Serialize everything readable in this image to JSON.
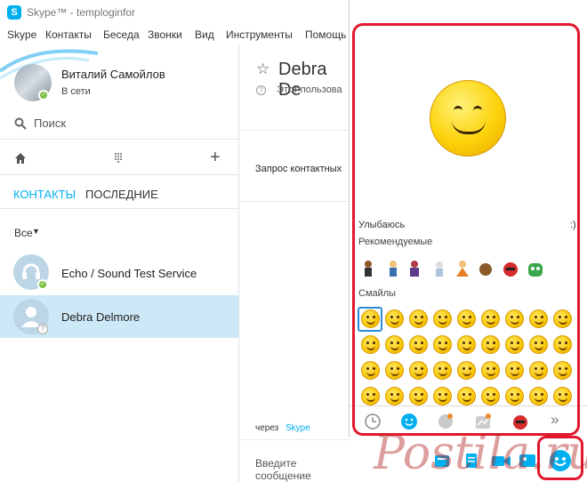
{
  "window": {
    "title": "Skype™ - temploginfor"
  },
  "menu": [
    "Skype",
    "Контакты",
    "Беседа",
    "Звонки",
    "Вид",
    "Инструменты",
    "Помощь"
  ],
  "profile": {
    "name": "Виталий Самойлов",
    "status": "В сети"
  },
  "search": {
    "label": "Поиск"
  },
  "tabs": {
    "contacts": "КОНТАКТЫ",
    "recent": "ПОСЛЕДНИЕ"
  },
  "filter": {
    "label": "Все"
  },
  "contacts": [
    {
      "name": "Echo / Sound Test Service"
    },
    {
      "name": "Debra Delmore"
    }
  ],
  "chat": {
    "title": "Debra De",
    "subtitle": "Этот пользова",
    "request": "Запрос контактных",
    "via_prefix": "через",
    "via_link": "Skype",
    "input_placeholder": "Введите сообщение"
  },
  "emoticons": {
    "preview_label": "Улыбаюсь",
    "preview_code": ":)",
    "recommended_label": "Рекомендуемые",
    "smileys_label": "Смайлы",
    "tabs_more": "»"
  },
  "colors": {
    "accent": "#00aff0",
    "highlight": "#e2182c",
    "selected_row": "#cde8f6",
    "status_online": "#7ac143"
  },
  "watermark": "Postila.ru"
}
